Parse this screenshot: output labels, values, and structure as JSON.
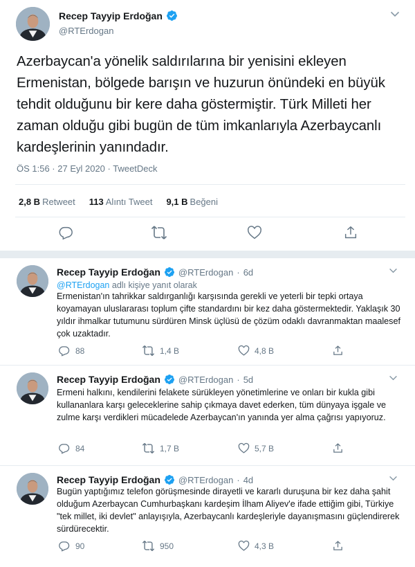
{
  "colors": {
    "link": "#1da1f2",
    "secondary_text": "#657786",
    "verified": "#1da1f2",
    "divider": "#e6ecf0"
  },
  "main_tweet": {
    "name": "Recep Tayyip Erdoğan",
    "handle": "@RTErdogan",
    "text": "Azerbaycan'a yönelik saldırılarına bir yenisini ekleyen Ermenistan, bölgede barışın ve huzurun önündeki en büyük tehdit olduğunu bir kere daha göstermiştir. Türk Milleti her zaman olduğu gibi bugün de tüm imkanlarıyla Azerbaycanlı kardeşlerinin yanındadır.",
    "meta": "ÖS 1:56 · 27 Eyl 2020 · TweetDeck",
    "stats": [
      {
        "value": "2,8 B",
        "label": "Retweet"
      },
      {
        "value": "113",
        "label": "Alıntı Tweet"
      },
      {
        "value": "9,1 B",
        "label": "Beğeni"
      }
    ],
    "actions": [
      "reply-icon",
      "retweet-icon",
      "like-icon",
      "share-icon"
    ]
  },
  "replies": [
    {
      "name": "Recep Tayyip Erdoğan",
      "handle": "@RTErdogan",
      "time": "6d",
      "reply_to_handle": "@RTErdogan",
      "reply_to_suffix": "adlı kişiye yanıt olarak",
      "text": "Ermenistan'ın tahrikkar saldırganlığı karşısında gerekli ve yeterli bir tepki ortaya koyamayan uluslararası toplum çifte standardını bir kez daha göstermektedir. Yaklaşık 30 yıldır ihmalkar tutumunu sürdüren Minsk üçlüsü de çözüm odaklı davranmaktan maalesef çok uzaktadır.",
      "replies": "88",
      "retweets": "1,4 B",
      "likes": "4,8 B"
    },
    {
      "name": "Recep Tayyip Erdoğan",
      "handle": "@RTErdogan",
      "time": "5d",
      "text": "Ermeni halkını, kendilerini felakete sürükleyen yönetimlerine ve onları bir kukla gibi kullananlara karşı geleceklerine sahip çıkmaya davet ederken, tüm dünyaya işgale ve zulme karşı verdikleri mücadelede Azerbaycan'ın yanında yer alma çağrısı yapıyoruz.",
      "replies": "84",
      "retweets": "1,7 B",
      "likes": "5,7 B"
    },
    {
      "name": "Recep Tayyip Erdoğan",
      "handle": "@RTErdogan",
      "time": "4d",
      "text": "Bugün yaptığımız telefon görüşmesinde dirayetli ve kararlı duruşuna bir kez daha şahit olduğum Azerbaycan Cumhurbaşkanı kardeşim İlham Aliyev'e ifade ettiğim gibi, Türkiye \"tek millet, iki devlet\" anlayışıyla, Azerbaycanlı kardeşleriyle dayanışmasını güçlendirerek sürdürecektir.",
      "replies": "90",
      "retweets": "950",
      "likes": "4,3 B"
    }
  ]
}
